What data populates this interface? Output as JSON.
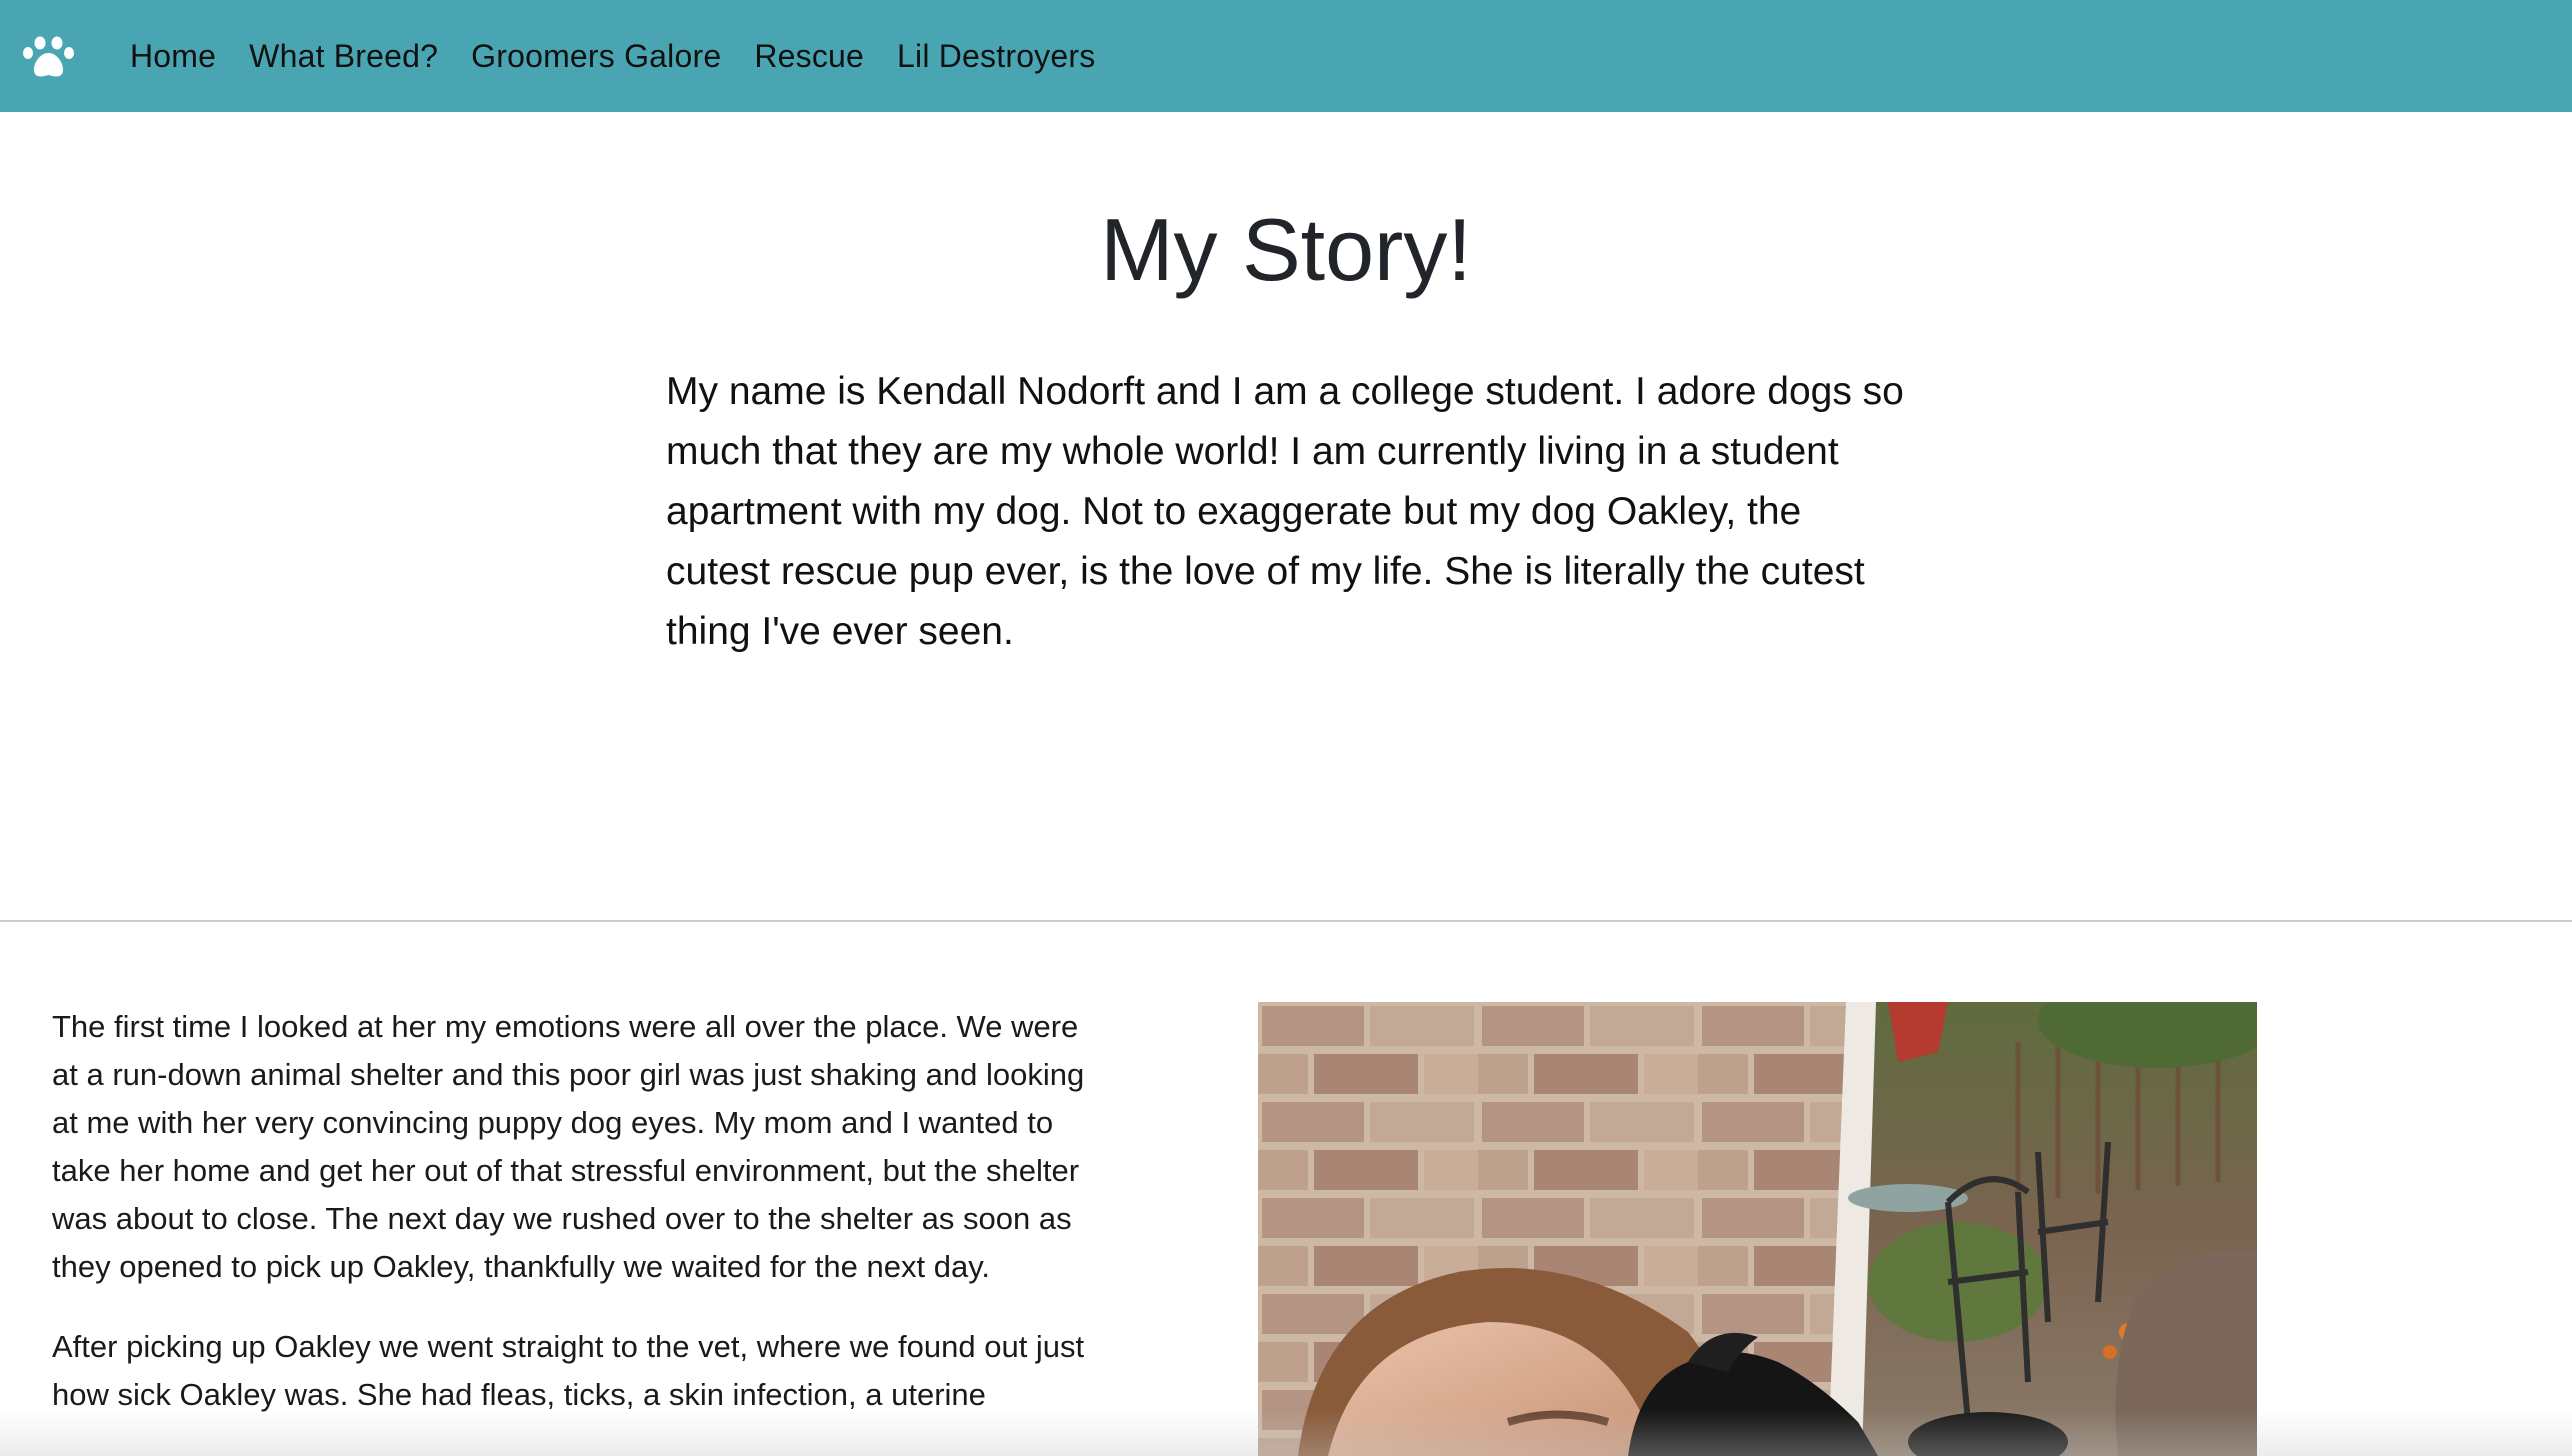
{
  "nav": {
    "brand_icon": "paw-icon",
    "links": [
      "Home",
      "What Breed?",
      "Groomers Galore",
      "Rescue",
      "Lil Destroyers"
    ]
  },
  "colors": {
    "navbar": "#4aa5b3",
    "text": "#212529"
  },
  "main": {
    "title": "My Story!",
    "intro": "My name is Kendall Nodorft and I am a college student. I adore dogs so much that they are my whole world! I am currently living in a student apartment with my dog. Not to exaggerate but my dog Oakley, the cutest rescue pup ever, is the love of my life. She is literally the cutest thing I've ever seen."
  },
  "story": {
    "paragraph_1": "The first time I looked at her my emotions were all over the place. We were at a run-down animal shelter and this poor girl was just shaking and looking at me with her very convincing puppy dog eyes. My mom and I wanted to take her home and get her out of that stressful environment, but the shelter was about to close. The next day we rushed over to the shelter as soon as they opened to pick up Oakley, thankfully we waited for the next day.",
    "paragraph_2": "After picking up Oakley we went straight to the vet, where we found out just how sick Oakley was. She had fleas, ticks, a skin infection, a uterine"
  },
  "photo": {
    "icon": "photo-of-girl-with-dog"
  }
}
